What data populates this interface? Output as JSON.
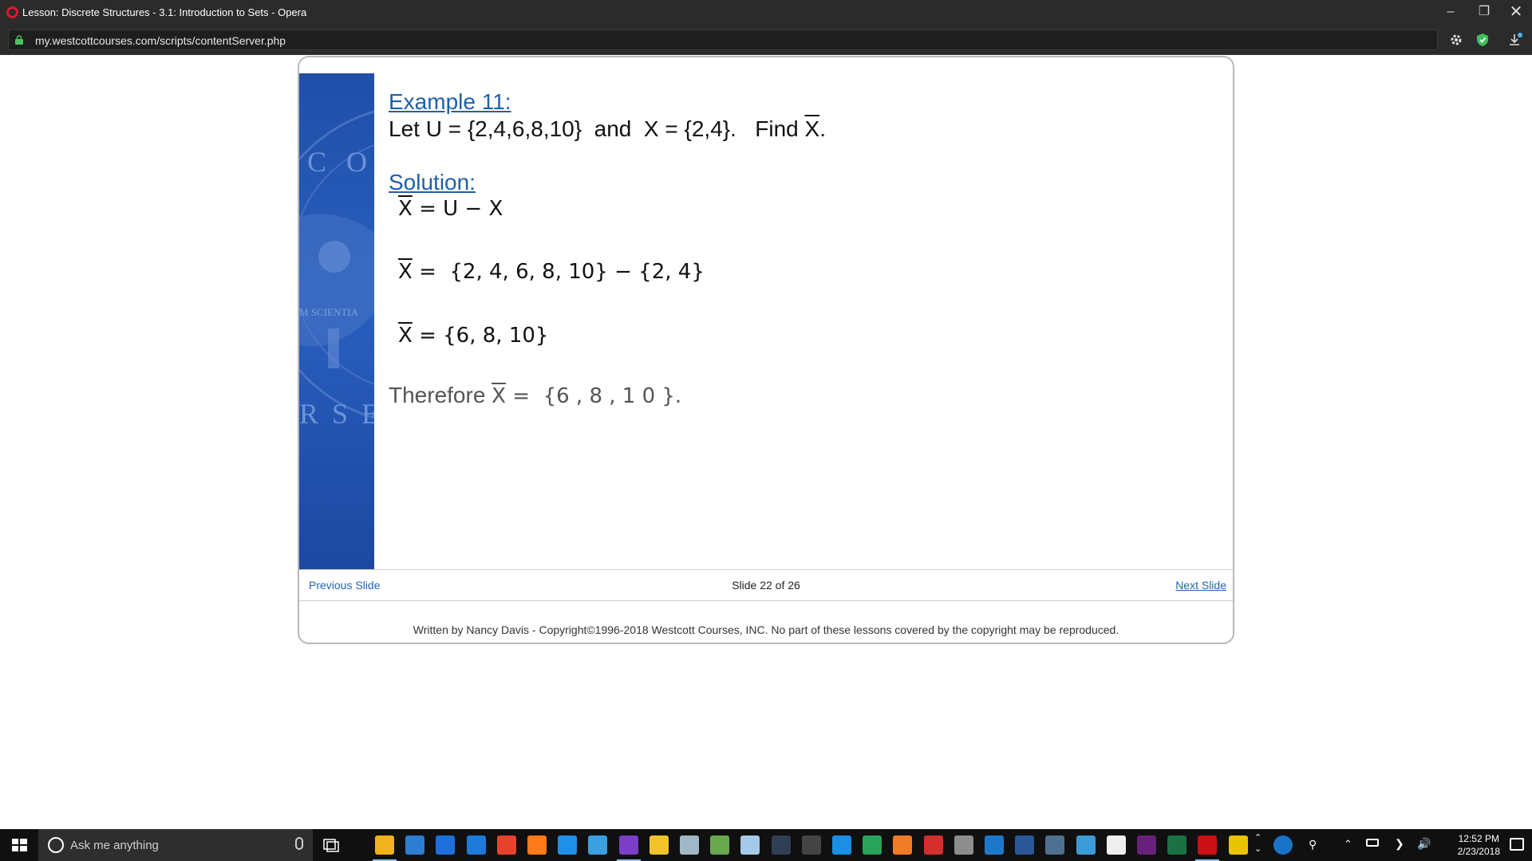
{
  "window": {
    "title": "Lesson: Discrete Structures - 3.1: Introduction to Sets - Opera",
    "url": "my.westcottcourses.com/scripts/contentServer.php"
  },
  "slide": {
    "example_heading": "Example 11:",
    "problem": {
      "prefix": "Let U = {2,4,6,8,10}  and  X = {2,4}.   Find ",
      "target": "X",
      "suffix": "."
    },
    "solution_heading": "Solution:",
    "steps": [
      {
        "lhs": "X",
        "rhs": "= U − X"
      },
      {
        "lhs": "X",
        "rhs": "=  {2, 4, 6, 8, 10} − {2, 4}"
      },
      {
        "lhs": "X",
        "rhs": "= {6, 8, 10}"
      }
    ],
    "conclusion": {
      "prefix": "Therefore ",
      "var": "X",
      "rhs": " =  {6 , 8 , 1 0 }."
    },
    "seal_text_1": "C O",
    "seal_text_2": "M SCIENTIA",
    "seal_text_3": "R S E S"
  },
  "nav": {
    "previous_label": "Previous Slide",
    "counter": "Slide 22 of 26",
    "next_label": "Next Slide"
  },
  "footer": {
    "copyright": "Written by Nancy Davis - Copyright©1996-2018 Westcott Courses, INC. No part of these lessons covered by the copyright may be reproduced."
  },
  "taskbar": {
    "search_placeholder": "Ask me anything",
    "time": "12:52 PM",
    "date": "2/23/2018",
    "apps": [
      "file-explorer",
      "store",
      "xamarin",
      "edge",
      "chrome",
      "firefox",
      "ie",
      "azure",
      "dp",
      "star",
      "paint",
      "lambda",
      "notepad",
      "kindle",
      "calculator",
      "teamviewer",
      "camtasia",
      "xampp",
      "filezilla",
      "terminal",
      "outlook",
      "word",
      "remote",
      "mail-app",
      "mail",
      "visual-studio",
      "excel",
      "opera",
      "sticky"
    ]
  },
  "colors": {
    "chrome_dark": "#2b2b2b",
    "slide_blue": "#1f4fa8",
    "heading_blue": "#1f5faa",
    "link_blue": "#1e63b8",
    "opera_red": "#e0182d"
  }
}
